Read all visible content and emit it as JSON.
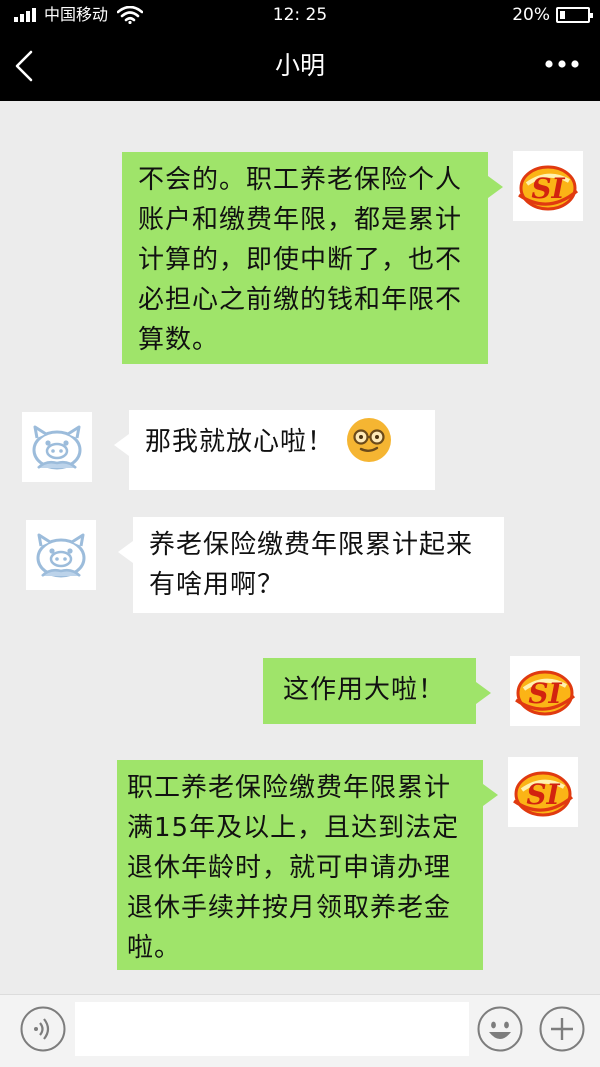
{
  "status_bar": {
    "carrier": "中国移动",
    "time": "12: 25",
    "battery_percent": "20%",
    "battery_level": 0.2,
    "signal_bars": 4
  },
  "header": {
    "title": "小明",
    "back_icon": "chevron-left-icon",
    "more_icon": "more-dots-icon"
  },
  "messages": [
    {
      "side": "right",
      "sender": "si-logo",
      "text": "不会的。职工养老保险个人账户和缴费年限，都是累计计算的，即使中断了，也不必担心之前缴的钱和年限不算数。"
    },
    {
      "side": "left",
      "sender": "pig-avatar",
      "text": "那我就放心啦！",
      "emoji": "nerd-face-emoji"
    },
    {
      "side": "left",
      "sender": "pig-avatar",
      "text": "养老保险缴费年限累计起来有啥用啊？"
    },
    {
      "side": "right",
      "sender": "si-logo",
      "text": "这作用大啦！"
    },
    {
      "side": "right",
      "sender": "si-logo",
      "text": "职工养老保险缴费年限累计满15年及以上，且达到法定退休年龄时，就可申请办理退休手续并按月领取养老金啦。"
    }
  ],
  "input_bar": {
    "message_value": "",
    "voice_icon": "voice-icon",
    "emoji_icon": "emoji-icon",
    "add_icon": "plus-icon"
  },
  "colors": {
    "header_bg": "#000000",
    "chat_bg": "#ececec",
    "outgoing_bubble": "#9fe46a",
    "incoming_bubble": "#ffffff"
  }
}
